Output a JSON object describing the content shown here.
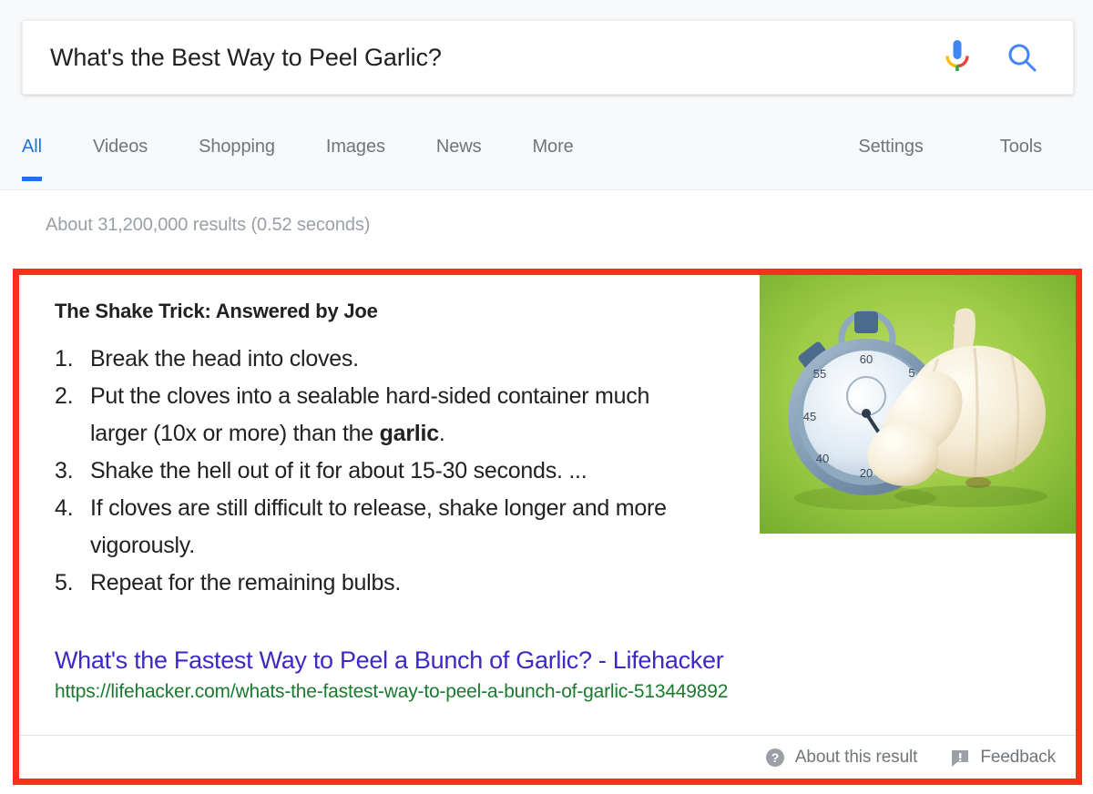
{
  "search": {
    "query": "What's the Best Way to Peel Garlic?",
    "placeholder": "Search",
    "mic_icon": "microphone-icon",
    "search_icon": "search-icon"
  },
  "nav": {
    "tabs": [
      {
        "label": "All",
        "active": true
      },
      {
        "label": "Videos",
        "active": false
      },
      {
        "label": "Shopping",
        "active": false
      },
      {
        "label": "Images",
        "active": false
      },
      {
        "label": "News",
        "active": false
      },
      {
        "label": "More",
        "active": false
      }
    ],
    "right": [
      {
        "label": "Settings"
      },
      {
        "label": "Tools"
      }
    ]
  },
  "results": {
    "stats": "About 31,200,000 results (0.52 seconds)"
  },
  "snippet": {
    "title": "The Shake Trick: Answered by Joe",
    "steps": [
      {
        "text": "Break the head into cloves.",
        "bold": "",
        "tail": ""
      },
      {
        "text": "Put the cloves into a sealable hard-sided container much larger (10x or more) than the ",
        "bold": "garlic",
        "tail": "."
      },
      {
        "text": "Shake the hell out of it for about 15-30 seconds. ...",
        "bold": "",
        "tail": ""
      },
      {
        "text": "If cloves are still difficult to release, shake longer and more vigorously.",
        "bold": "",
        "tail": ""
      },
      {
        "text": "Repeat for the remaining bulbs.",
        "bold": "",
        "tail": ""
      }
    ],
    "link_title": "What's the Fastest Way to Peel a Bunch of Garlic? - Lifehacker",
    "link_url": "https://lifehacker.com/whats-the-fastest-way-to-peel-a-bunch-of-garlic-513449892",
    "thumbnail_alt": "stopwatch-and-garlic-bulb-image",
    "footer": [
      {
        "label": "About this result",
        "icon": "help-circle-icon"
      },
      {
        "label": "Feedback",
        "icon": "feedback-icon"
      }
    ]
  },
  "colors": {
    "highlight_border": "#fa2f1c",
    "active_tab": "#1a73e8",
    "link": "#3d29c3",
    "url": "#1a7a2e",
    "muted_text": "#70757a",
    "thumb_green": "#8dc63f"
  }
}
